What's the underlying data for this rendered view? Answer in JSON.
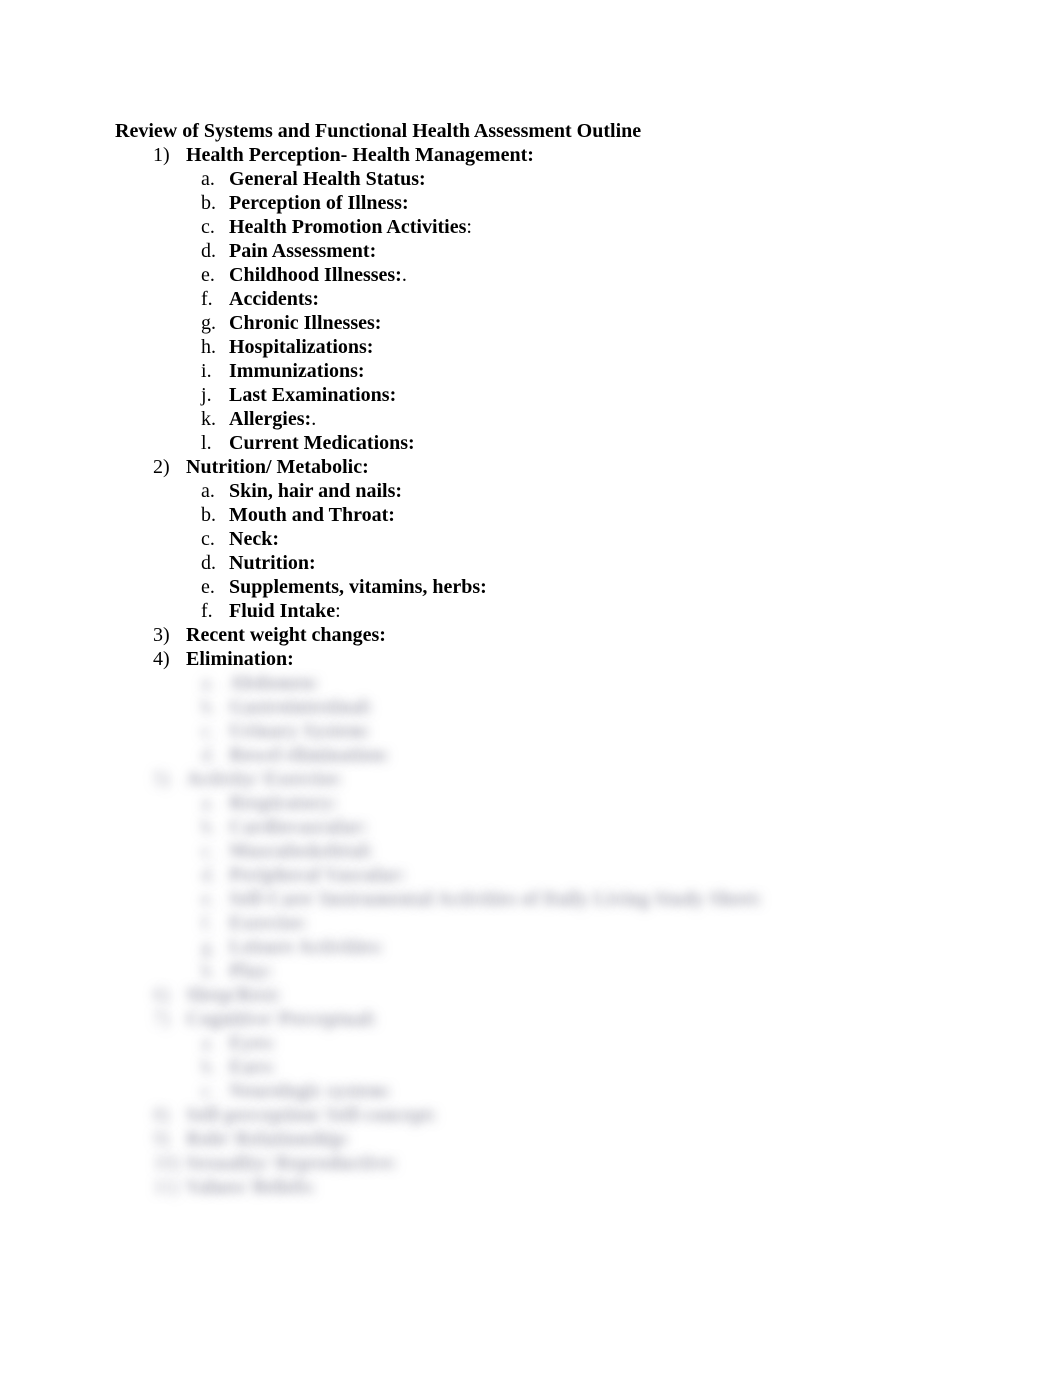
{
  "title": "Review of Systems and Functional Health Assessment Outline",
  "sections": {
    "s1": {
      "label": "Health Perception- Health Management:",
      "items": {
        "a": "General Health Status:",
        "b": "Perception of Illness:",
        "c": "Health Promotion Activities",
        "c_colon": ":",
        "d": "Pain Assessment:",
        "e": "Childhood Illnesses:",
        "e_dot": ".",
        "f": "Accidents:",
        "g": "Chronic Illnesses:",
        "h": "Hospitalizations:",
        "i": "Immunizations:",
        "j": "Last Examinations:",
        "k": "Allergies:",
        "k_dot": ".",
        "l": "Current Medications:"
      }
    },
    "s2": {
      "label": "Nutrition/ Metabolic:",
      "items": {
        "a": "Skin, hair and nails:",
        "b": "Mouth and Throat:",
        "c": "Neck:",
        "d": "Nutrition:",
        "e": "Supplements, vitamins, herbs:",
        "f": "Fluid Intake",
        "f_colon": ":"
      }
    },
    "s3": {
      "label": "Recent weight changes:"
    },
    "s4": {
      "label": "Elimination:",
      "items": {
        "a": "Abdomen:",
        "b": "Gastrointestinal:",
        "c": "Urinary System:",
        "d": "Bowel elimination:"
      }
    },
    "s5": {
      "label": "Activity/ Exercise:",
      "items": {
        "a": "Respiratory:",
        "b": "Cardiovascular:",
        "c": "Musculoskeletal:",
        "d": "Peripheral Vascular:",
        "e": "Self-Care/ Instrumental Activities of Daily Living Study Sheet:",
        "f": "Exercise:",
        "g": "Leisure Activities:",
        "h": "Play:"
      }
    },
    "s6": {
      "label": "Sleep/Rest:"
    },
    "s7": {
      "label": "Cognitive/ Perceptual:",
      "items": {
        "a": "Eyes:",
        "b": "Ears:",
        "c": "Neurologic system:"
      }
    },
    "s8": {
      "label": "Self-perception/ Self-concept:"
    },
    "s9": {
      "label": "Role/ Relationship:"
    },
    "s10": {
      "label": "Sexuality/ Reproductive:"
    },
    "s11": {
      "label": "Values/ Beliefs:"
    }
  }
}
